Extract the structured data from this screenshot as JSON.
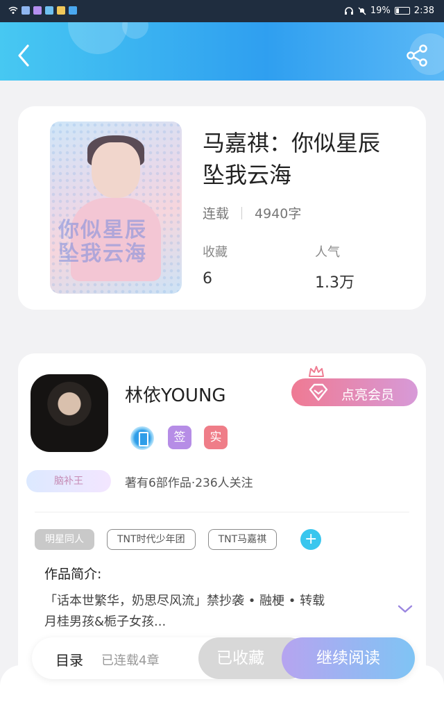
{
  "status": {
    "battery": "19%",
    "time": "2:38"
  },
  "book": {
    "title_line1": "马嘉祺：你似星辰",
    "title_line2": "坠我云海",
    "status": "连载",
    "word_count": "4940字",
    "collect_label": "收藏",
    "collect_value": "6",
    "popularity_label": "人气",
    "popularity_value": "1.3万"
  },
  "author": {
    "name": "林依YOUNG",
    "badge_sign": "签",
    "badge_real": "实",
    "vip_button": "点亮会员",
    "title_badge": "脑补王",
    "summary": "著有6部作品·236人关注"
  },
  "tags": [
    "明星同人",
    "TNT时代少年团",
    "TNT马嘉祺"
  ],
  "add_tag": "+",
  "intro": {
    "title": "作品简介:",
    "line1": "「话本世繁华，奶思尽风流」禁抄袭 • 融梗 • 转载",
    "line2": "月桂男孩&栀子女孩..."
  },
  "bottom": {
    "toc": "目录",
    "chapters": "已连载4章",
    "collected": "已收藏",
    "continue": "继续阅读"
  }
}
